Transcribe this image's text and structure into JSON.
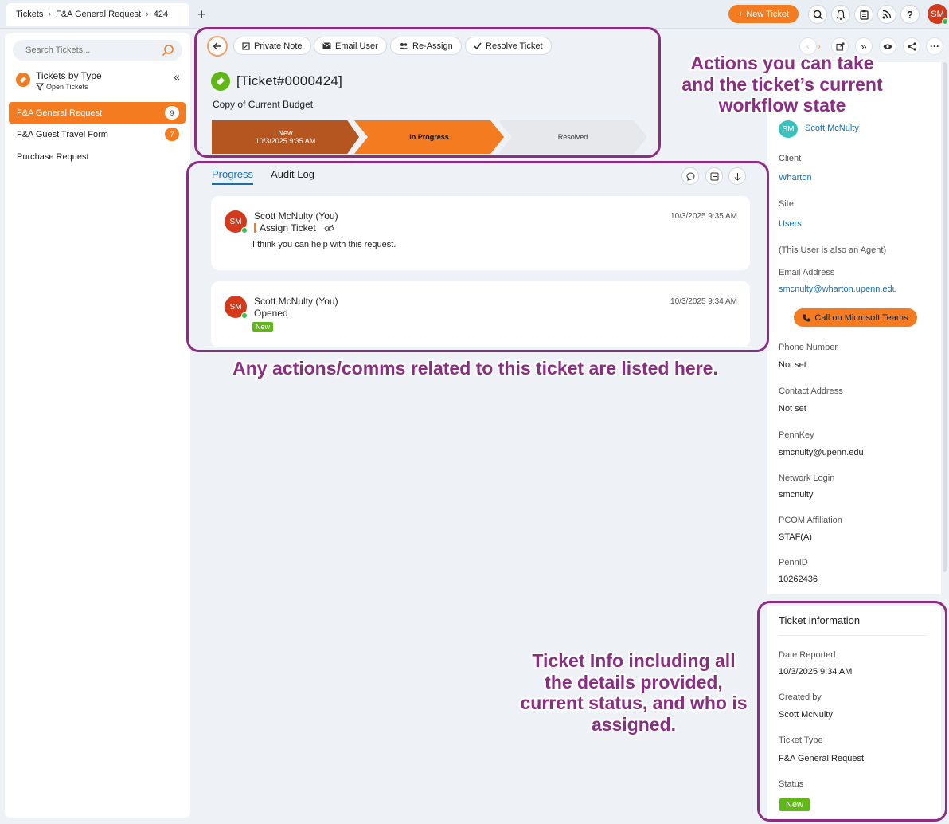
{
  "breadcrumb": {
    "root": "Tickets",
    "type": "F&A General Request",
    "id": "424"
  },
  "topbar": {
    "new_ticket": "New Ticket",
    "user_initials": "SM"
  },
  "sidebar": {
    "search_placeholder": "Search Tickets...",
    "section_title": "Tickets by Type",
    "filter_label": "Open Tickets",
    "items": [
      {
        "label": "F&A General Request",
        "count": "9",
        "active": true
      },
      {
        "label": "F&A Guest Travel Form",
        "count": "7",
        "active": false
      },
      {
        "label": "Purchase Request",
        "count": "",
        "active": false
      }
    ]
  },
  "actions": {
    "private_note": "Private Note",
    "email_user": "Email User",
    "reassign": "Re-Assign",
    "resolve": "Resolve Ticket"
  },
  "ticket": {
    "id": "[Ticket#0000424]",
    "subject": "Copy of Current Budget",
    "stages": [
      {
        "name": "New",
        "date": "10/3/2025 9:35 AM"
      },
      {
        "name": "In Progress"
      },
      {
        "name": "Resolved"
      }
    ]
  },
  "progress": {
    "tabs": [
      "Progress",
      "Audit Log"
    ],
    "entries": [
      {
        "initials": "SM",
        "author": "Scott McNulty (You)",
        "time": "10/3/2025 9:35 AM",
        "action": "Assign Ticket",
        "message": "I think you can help with this request."
      },
      {
        "initials": "SM",
        "author": "Scott McNulty (You)",
        "time": "10/3/2025 9:34 AM",
        "action": "Opened",
        "tag": "New"
      }
    ]
  },
  "contact": {
    "agent_initials": "SM",
    "agent_name": "Scott McNulty",
    "client_label": "Client",
    "client": "Wharton",
    "site_label": "Site",
    "site": "Users",
    "note": "(This User is also an Agent)",
    "email_label": "Email Address",
    "email": "smcnulty@wharton.upenn.edu",
    "teams_button": "Call on Microsoft Teams",
    "phone_label": "Phone Number",
    "phone": "Not set",
    "address_label": "Contact Address",
    "address": "Not set",
    "pennkey_label": "PennKey",
    "pennkey": "smcnulty@upenn.edu",
    "network_label": "Network Login",
    "network": "smcnulty",
    "pcom_label": "PCOM Affiliation",
    "pcom": "STAF(A)",
    "pennid_label": "PennID",
    "pennid": "10262436"
  },
  "ticket_info": {
    "title": "Ticket information",
    "date_label": "Date Reported",
    "date": "10/3/2025 9:34 AM",
    "created_label": "Created by",
    "created": "Scott McNulty",
    "type_label": "Ticket Type",
    "type": "F&A General Request",
    "status_label": "Status",
    "status": "New"
  },
  "annotations": {
    "actions": "Actions you can take and the ticket’s current workflow state",
    "comms": "Any actions/comms related to this ticket are listed here.",
    "info": "Ticket Info including all the details provided, current status, and who is assigned."
  },
  "colors": {
    "accent": "#f47b20",
    "annotation": "#8b2d82",
    "success": "#5fb816",
    "link": "#1a6fb0"
  }
}
